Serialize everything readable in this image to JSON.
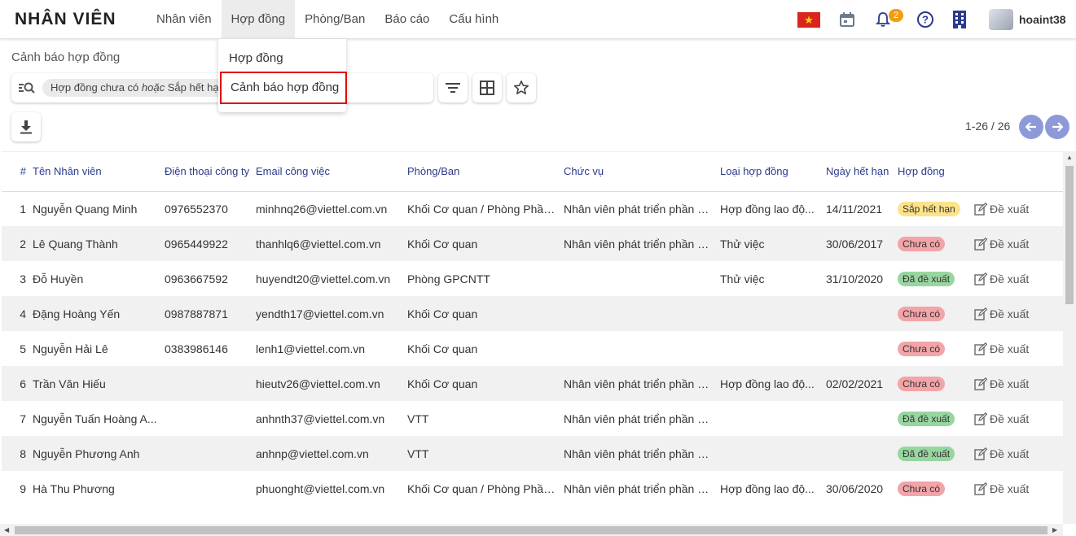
{
  "app": {
    "title": "NHÂN VIÊN",
    "username": "hoaint38",
    "notification_count": "2"
  },
  "menu": [
    "Nhân viên",
    "Hợp đồng",
    "Phòng/Ban",
    "Báo cáo",
    "Cấu hình"
  ],
  "dropdown": {
    "items": [
      "Hợp đồng",
      "Cảnh báo hợp đồng"
    ],
    "highlighted": "Cảnh báo hợp đồng"
  },
  "breadcrumb": "Cảnh báo hợp đồng",
  "search": {
    "facet_part1": "Hợp đồng chưa có ",
    "facet_or": "hoặc",
    "facet_part2": " Sắp hết hạn"
  },
  "pager": {
    "text": "1-26 / 26"
  },
  "icons": [
    "flag-vietnam-icon",
    "calendar-icon",
    "bell-icon",
    "help-icon",
    "building-icon",
    "search-filter-icon",
    "filter-icon",
    "grid-icon",
    "star-icon",
    "download-icon",
    "arrow-left-icon",
    "arrow-right-icon",
    "edit-icon"
  ],
  "colors": {
    "accent": "#2b3a8c",
    "status_warn": "#fce38a",
    "status_none": "#f3a4a8",
    "status_proposed": "#98d6a0",
    "pager_btn": "#8e9ad8",
    "highlight_border": "#e00000"
  },
  "table": {
    "headers": [
      "#",
      "Tên Nhân viên",
      "Điện thoại công ty",
      "Email công việc",
      "Phòng/Ban",
      "Chức vụ",
      "Loại hợp đồng",
      "Ngày hết hạn",
      "Hợp đồng"
    ],
    "action_label": "Đề xuất",
    "rows": [
      {
        "no": "1",
        "name": "Nguyễn Quang Minh",
        "phone": "0976552370",
        "email": "minhnq26@viettel.com.vn",
        "dept": "Khối Cơ quan / Phòng Phần ...",
        "position": "Nhân viên phát triển phần m...",
        "contract_type": "Hợp đồng lao độ...",
        "expiry": "14/11/2021",
        "status": "Sắp hết hạn",
        "status_kind": "warn"
      },
      {
        "no": "2",
        "name": "Lê Quang Thành",
        "phone": "0965449922",
        "email": "thanhlq6@viettel.com.vn",
        "dept": "Khối Cơ quan",
        "position": "Nhân viên phát triển phần m...",
        "contract_type": "Thử việc",
        "expiry": "30/06/2017",
        "status": "Chưa có",
        "status_kind": "none"
      },
      {
        "no": "3",
        "name": "Đỗ Huyền",
        "phone": "0963667592",
        "email": "huyendt20@viettel.com.vn",
        "dept": "Phòng GPCNTT",
        "position": "",
        "contract_type": "Thử việc",
        "expiry": "31/10/2020",
        "status": "Đã đề xuất",
        "status_kind": "proposed"
      },
      {
        "no": "4",
        "name": "Đặng Hoàng Yến",
        "phone": "0987887871",
        "email": "yendth17@viettel.com.vn",
        "dept": "Khối Cơ quan",
        "position": "",
        "contract_type": "",
        "expiry": "",
        "status": "Chưa có",
        "status_kind": "none"
      },
      {
        "no": "5",
        "name": "Nguyễn Hải Lê",
        "phone": "0383986146",
        "email": "lenh1@viettel.com.vn",
        "dept": "Khối Cơ quan",
        "position": "",
        "contract_type": "",
        "expiry": "",
        "status": "Chưa có",
        "status_kind": "none"
      },
      {
        "no": "6",
        "name": "Trần Văn Hiếu",
        "phone": "",
        "email": "hieutv26@viettel.com.vn",
        "dept": "Khối Cơ quan",
        "position": "Nhân viên phát triển phần m...",
        "contract_type": "Hợp đồng lao độ...",
        "expiry": "02/02/2021",
        "status": "Chưa có",
        "status_kind": "none"
      },
      {
        "no": "7",
        "name": "Nguyễn Tuấn Hoàng A...",
        "phone": "",
        "email": "anhnth37@viettel.com.vn",
        "dept": "VTT",
        "position": "Nhân viên phát triển phần m...",
        "contract_type": "",
        "expiry": "",
        "status": "Đã đề xuất",
        "status_kind": "proposed"
      },
      {
        "no": "8",
        "name": "Nguyễn Phương Anh",
        "phone": "",
        "email": "anhnp@viettel.com.vn",
        "dept": "VTT",
        "position": "Nhân viên phát triển phần m...",
        "contract_type": "",
        "expiry": "",
        "status": "Đã đề xuất",
        "status_kind": "proposed"
      },
      {
        "no": "9",
        "name": "Hà Thu Phương",
        "phone": "",
        "email": "phuonght@viettel.com.vn",
        "dept": "Khối Cơ quan / Phòng Phần ...",
        "position": "Nhân viên phát triển phần m...",
        "contract_type": "Hợp đồng lao độ...",
        "expiry": "30/06/2020",
        "status": "Chưa có",
        "status_kind": "none"
      }
    ]
  }
}
